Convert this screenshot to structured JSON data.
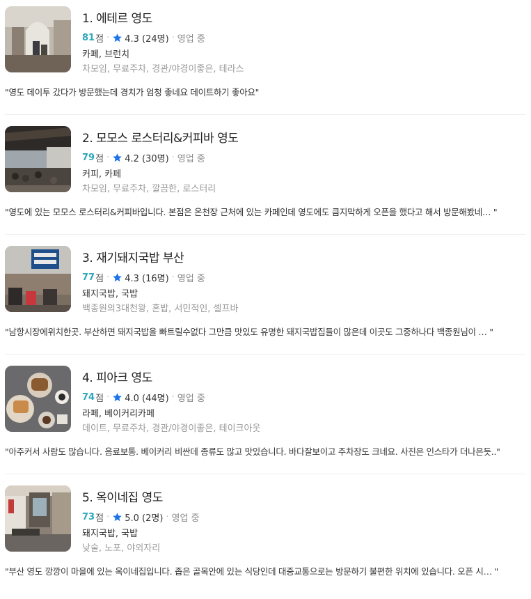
{
  "colors": {
    "score": "#2aa7b8",
    "star": "#1a73e8",
    "divider": "#eeeeee"
  },
  "places": [
    {
      "title": "1. 에테르 영도",
      "score": "81",
      "score_unit": "점",
      "rating": "4.3 (24명)",
      "status": "영업 중",
      "category": "카페, 브런치",
      "tags": "차모임, 무료주차, 경관/야경이좋은, 테라스",
      "review": "\"영도 데이투 갔다가 방문했는데 경치가 엄청 좋네요 데이트하기 좋아요\""
    },
    {
      "title": "2. 모모스 로스터리&커피바 영도",
      "score": "79",
      "score_unit": "점",
      "rating": "4.2 (30명)",
      "status": "영업 중",
      "category": "커피, 카페",
      "tags": "차모임, 무료주차, 깔끔한, 로스터리",
      "review": "\"영도에 있는 모모스 로스터리&커피바입니다. 본점은 온천장 근처에 있는 카페인데 영도에도 큼지막하게 오픈을 했다고 해서 방문해봤네… \""
    },
    {
      "title": "3. 재기돼지국밥 부산",
      "score": "77",
      "score_unit": "점",
      "rating": "4.3 (16명)",
      "status": "영업 중",
      "category": "돼지국밥, 국밥",
      "tags": "백종원의3대천왕, 혼밥, 서민적인, 셀프바",
      "review": "\"남항시장에위치한곳. 부산하면 돼지국밥을 빠트릴수없다 그만큼 맛있도 유명한 돼지국밥집들이 많은데 이곳도 그중하나다 백종원님이 … \""
    },
    {
      "title": "4. 피아크 영도",
      "score": "74",
      "score_unit": "점",
      "rating": "4.0 (44명)",
      "status": "영업 중",
      "category": "라페, 베이커리카페",
      "tags": "데이트, 무료주차, 경관/야경이좋은, 테이크아웃",
      "review": "\"아주커서 사람도 많습니다. 음료보통. 베이커리 비싼데 종류도 많고 맛있습니다. 바다잘보이고 주차장도 크네요. 사진은 인스타가 더나은듯..\""
    },
    {
      "title": "5. 옥이네집 영도",
      "score": "73",
      "score_unit": "점",
      "rating": "5.0 (2명)",
      "status": "영업 중",
      "category": "돼지국밥, 국밥",
      "tags": "낮술, 노포, 야외자리",
      "review": "\"부산 영도 깡깡이 마을에 있는 옥이네집입니다. 좁은 골목안에 있는 식당인데 대중교통으로는 방문하기 불편한 위치에 있습니다. 오픈 시… \""
    }
  ]
}
